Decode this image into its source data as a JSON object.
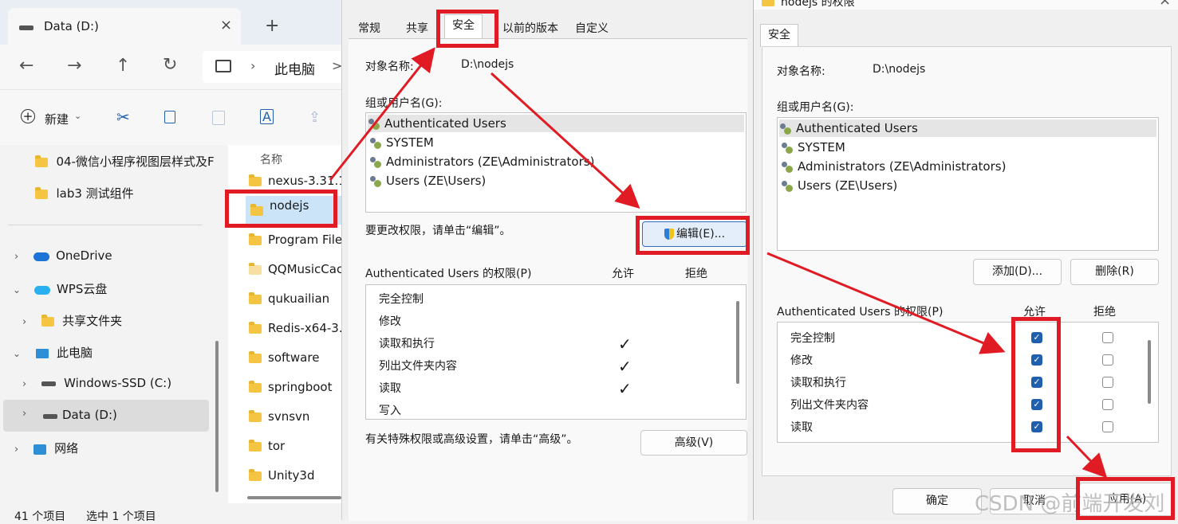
{
  "explorer": {
    "tab_title": "Data (D:)",
    "new_tab": "+",
    "breadcrumb": [
      "此电脑",
      ">"
    ],
    "new_label": "新建",
    "status_items": "41 个项目",
    "status_selected": "选中 1 个项目",
    "name_header": "名称",
    "nav": [
      {
        "label": "04-微信小程序视图层样式及F",
        "icon": "folder"
      },
      {
        "label": "lab3 测试组件",
        "icon": "folder"
      },
      {
        "label": "OneDrive",
        "icon": "cloud"
      },
      {
        "label": "WPS云盘",
        "icon": "cloud"
      },
      {
        "label": "共享文件夹",
        "icon": "shared-folder"
      },
      {
        "label": "此电脑",
        "icon": "pc"
      },
      {
        "label": "Windows-SSD (C:)",
        "icon": "drive"
      },
      {
        "label": "Data (D:)",
        "icon": "drive"
      },
      {
        "label": "网络",
        "icon": "network"
      }
    ],
    "files": [
      "nexus-3.31.1",
      "nodejs",
      "Program File",
      "QQMusicCac",
      "qukuailian",
      "Redis-x64-3.",
      "software",
      "springboot",
      "svnsvn",
      "tor",
      "Unity3d"
    ]
  },
  "dialog1": {
    "tabs": [
      "常规",
      "共享",
      "安全",
      "以前的版本",
      "自定义"
    ],
    "object_label": "对象名称:",
    "object_value": "D:\\nodejs",
    "group_label": "组或用户名(G):",
    "users": [
      "Authenticated Users",
      "SYSTEM",
      "Administrators (ZE\\Administrators)",
      "Users (ZE\\Users)"
    ],
    "edit_hint": "要更改权限，请单击“编辑”。",
    "edit_button": "编辑(E)...",
    "perm_title": "Authenticated Users 的权限(P)",
    "allow": "允许",
    "deny": "拒绝",
    "perms": [
      {
        "name": "完全控制",
        "allow": false
      },
      {
        "name": "修改",
        "allow": false
      },
      {
        "name": "读取和执行",
        "allow": true
      },
      {
        "name": "列出文件夹内容",
        "allow": true
      },
      {
        "name": "读取",
        "allow": true
      },
      {
        "name": "写入",
        "allow": false
      }
    ],
    "advanced_hint": "有关特殊权限或高级设置，请单击“高级”。",
    "advanced_button": "高级(V)",
    "check": "✓"
  },
  "dialog2": {
    "title": "nodejs 的权限",
    "tab": "安全",
    "object_label": "对象名称:",
    "object_value": "D:\\nodejs",
    "group_label": "组或用户名(G):",
    "users": [
      "Authenticated Users",
      "SYSTEM",
      "Administrators (ZE\\Administrators)",
      "Users (ZE\\Users)"
    ],
    "add_button": "添加(D)...",
    "remove_button": "删除(R)",
    "perm_title": "Authenticated Users 的权限(P)",
    "allow": "允许",
    "deny": "拒绝",
    "perms": [
      {
        "name": "完全控制",
        "allow": true,
        "deny": false
      },
      {
        "name": "修改",
        "allow": true,
        "deny": false
      },
      {
        "name": "读取和执行",
        "allow": true,
        "deny": false
      },
      {
        "name": "列出文件夹内容",
        "allow": true,
        "deny": false
      },
      {
        "name": "读取",
        "allow": true,
        "deny": false
      }
    ],
    "ok_button": "确定",
    "cancel_button": "取消",
    "apply_button": "应用(A)",
    "close": "×"
  },
  "watermark": "CSDN @前端开发刘",
  "colors": {
    "annotation": "#e01b24",
    "checkbox": "#1f5fae",
    "folder": "#f4c542"
  }
}
